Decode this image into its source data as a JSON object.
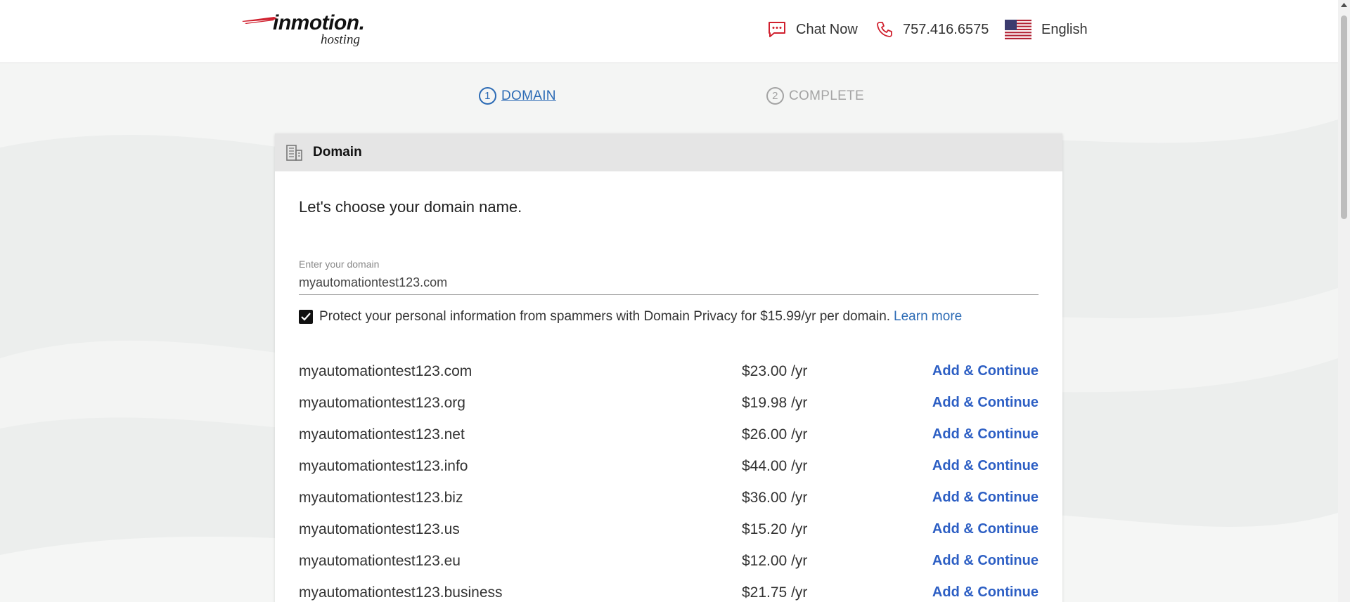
{
  "header": {
    "logo_brand": "inmotion.",
    "logo_sub": "hosting",
    "chat_label": "Chat Now",
    "phone": "757.416.6575",
    "language": "English"
  },
  "steps": [
    {
      "number": "1",
      "label": "DOMAIN",
      "active": true
    },
    {
      "number": "2",
      "label": "COMPLETE",
      "active": false
    }
  ],
  "card": {
    "title": "Domain",
    "subtitle": "Let's choose your domain name.",
    "input_label": "Enter your domain",
    "input_value": "myautomationtest123.com",
    "privacy_text": "Protect your personal information from spammers with Domain Privacy for $15.99/yr per domain.",
    "privacy_link": "Learn more",
    "privacy_checked": true
  },
  "results": [
    {
      "domain": "myautomationtest123.com",
      "price": "$23.00 /yr",
      "action": "Add & Continue"
    },
    {
      "domain": "myautomationtest123.org",
      "price": "$19.98 /yr",
      "action": "Add & Continue"
    },
    {
      "domain": "myautomationtest123.net",
      "price": "$26.00 /yr",
      "action": "Add & Continue"
    },
    {
      "domain": "myautomationtest123.info",
      "price": "$44.00 /yr",
      "action": "Add & Continue"
    },
    {
      "domain": "myautomationtest123.biz",
      "price": "$36.00 /yr",
      "action": "Add & Continue"
    },
    {
      "domain": "myautomationtest123.us",
      "price": "$15.20 /yr",
      "action": "Add & Continue"
    },
    {
      "domain": "myautomationtest123.eu",
      "price": "$12.00 /yr",
      "action": "Add & Continue"
    },
    {
      "domain": "myautomationtest123.business",
      "price": "$21.75 /yr",
      "action": "Add & Continue"
    }
  ],
  "colors": {
    "accent_link": "#2c6bb5",
    "action_link": "#2d5fc4",
    "brand_red": "#d0202e",
    "step_inactive": "#a4a4a4"
  },
  "icons": {
    "chat": "chat-bubble-icon",
    "phone": "phone-icon",
    "flag": "us-flag-icon",
    "card_header": "building-icon",
    "checkbox": "checkmark-icon"
  }
}
